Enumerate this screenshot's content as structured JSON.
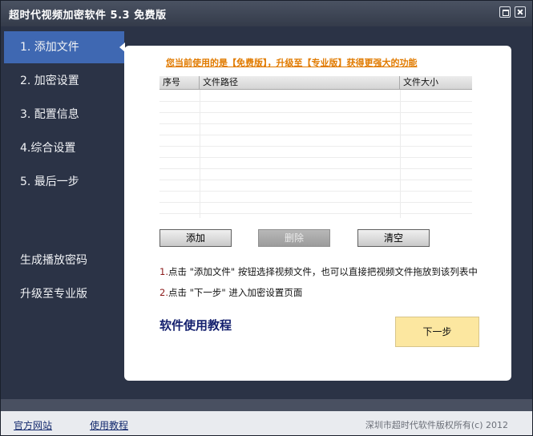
{
  "window": {
    "title": "超时代视频加密软件 5.3 免费版"
  },
  "sidebar": {
    "items": [
      {
        "label": "1. 添加文件"
      },
      {
        "label": "2. 加密设置"
      },
      {
        "label": "3. 配置信息"
      },
      {
        "label": "4.综合设置"
      },
      {
        "label": "5. 最后一步"
      },
      {
        "label": "生成播放密码"
      },
      {
        "label": "升级至专业版"
      }
    ]
  },
  "main": {
    "promo": "您当前使用的是【免费版】，升级至【专业版】获得更强大的功能",
    "table": {
      "headers": [
        "序号",
        "文件路径",
        "文件大小"
      ]
    },
    "buttons": {
      "add": "添加",
      "delete": "删除",
      "clear": "清空"
    },
    "hints": [
      {
        "num": "1.",
        "text": "点击 \"添加文件\" 按钮选择视频文件，也可以直接把视频文件拖放到该列表中"
      },
      {
        "num": "2.",
        "text": "点击 \"下一步\" 进入加密设置页面"
      }
    ],
    "tutorial": "软件使用教程",
    "next": "下一步"
  },
  "footer": {
    "official_site": "官方网站",
    "tutorial": "使用教程",
    "copyright": "深圳市超时代软件版权所有(c) 2012"
  },
  "colors": {
    "accent": "#3f68b2",
    "promo": "#e17b00",
    "next_button": "#fce7a0"
  }
}
